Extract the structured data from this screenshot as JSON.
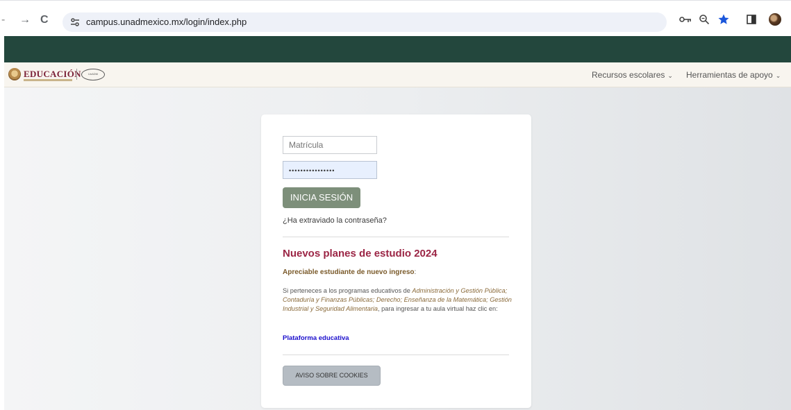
{
  "browser": {
    "url": "campus.unadmexico.mx/login/index.php"
  },
  "site": {
    "brand": "EDUCACIÓN",
    "unadm_logo_text": "UnADM",
    "nav": [
      {
        "label": "Recursos escolares"
      },
      {
        "label": "Herramientas de apoyo"
      }
    ]
  },
  "login": {
    "username_placeholder": "Matrícula",
    "password_mask": "••••••••••••••••",
    "submit_label": "INICIA SESIÓN",
    "forgot_label": "¿Ha extraviado la contraseña?"
  },
  "news": {
    "title": "Nuevos planes de estudio 2024",
    "greeting": "Apreciable estudiante de nuevo ingreso",
    "greeting_suffix": ":",
    "body_intro": "Si perteneces a los programas educativos de ",
    "programs": "Administración y Gestión Pública; Contaduría y Finanzas Públicas; Derecho; Enseñanza de la Matemática; Gestión Industrial y Seguridad Alimentaria",
    "body_outro": ", para ingresar a tu aula virtual haz clic en:",
    "link_label": "Plataforma educativa"
  },
  "cookies": {
    "label": "AVISO SOBRE COOKIES"
  },
  "colors": {
    "green_band": "#23473d",
    "accent_title": "#9b2545",
    "login_button": "#7d8f7a",
    "link": "#1a0dcc"
  }
}
